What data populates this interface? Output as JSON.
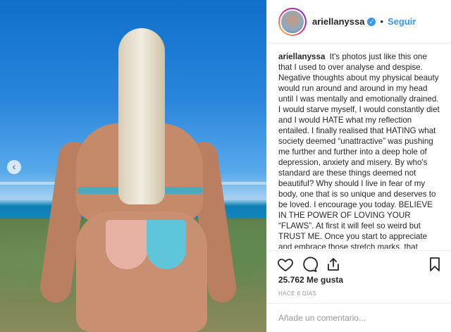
{
  "header": {
    "username": "ariellanyssa",
    "separator": "•",
    "follow_label": "Seguir"
  },
  "caption": {
    "username": "ariellanyssa",
    "text": "It's photos just like this one that I used to over analyse and despise. Negative thoughts about my physical beauty would run around and around in my head until I was mentally and emotionally drained. I would starve myself, I would constantly diet and I would HATE what my reflection entailed. I finally realised that HATING what society deemed “unattractive” was pushing me further and further into a deep hole of depression, anxiety and misery. By who's standard are these things deemed not beautiful? Why should I live in fear of my body, one that is so unique and deserves to be loved. I encourage you today. BELIEVE IN THE POWER OF LOVING YOUR “FLAWS”. At first it will feel so weird but TRUST ME. Once you start to appreciate and embrace those stretch marks, that cellulite, those lumps"
  },
  "stats": {
    "likes": "25.762 Me gusta",
    "time": "HACE 6 DÍAS"
  },
  "comment": {
    "placeholder": "Añade un comentario..."
  },
  "icons": {
    "like": "heart-icon",
    "comment": "comment-icon",
    "share": "share-icon",
    "save": "bookmark-icon",
    "prev": "chevron-left-icon",
    "verified": "verified-badge-icon"
  },
  "colors": {
    "accent": "#3897f0",
    "text": "#262626",
    "muted": "#999999"
  }
}
